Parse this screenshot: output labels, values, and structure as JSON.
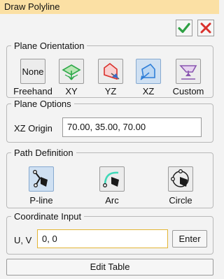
{
  "window": {
    "title": "Draw Polyline"
  },
  "actions": {
    "ok_icon": "check-icon",
    "cancel_icon": "close-icon",
    "ok_color": "#2ea043",
    "cancel_color": "#d9302b"
  },
  "plane_orientation": {
    "legend": "Plane Orientation",
    "none_button": "None",
    "options": [
      {
        "label": "Freehand",
        "icon": "none-icon"
      },
      {
        "label": "XY",
        "icon": "xy-plane-icon"
      },
      {
        "label": "YZ",
        "icon": "yz-plane-icon"
      },
      {
        "label": "XZ",
        "icon": "xz-plane-icon",
        "selected": true
      },
      {
        "label": "Custom",
        "icon": "custom-plane-icon"
      }
    ]
  },
  "plane_options": {
    "legend": "Plane Options",
    "origin_label": "XZ Origin",
    "origin_value": "70.00, 35.00, 70.00"
  },
  "path_definition": {
    "legend": "Path Definition",
    "options": [
      {
        "label": "P-line",
        "icon": "pline-icon",
        "selected": true
      },
      {
        "label": "Arc",
        "icon": "arc-icon"
      },
      {
        "label": "Circle",
        "icon": "circle-icon"
      }
    ]
  },
  "coordinate_input": {
    "legend": "Coordinate Input",
    "label": "U, V",
    "value": "0, 0",
    "enter_button": "Enter"
  },
  "footer": {
    "edit_table_button": "Edit Table"
  }
}
